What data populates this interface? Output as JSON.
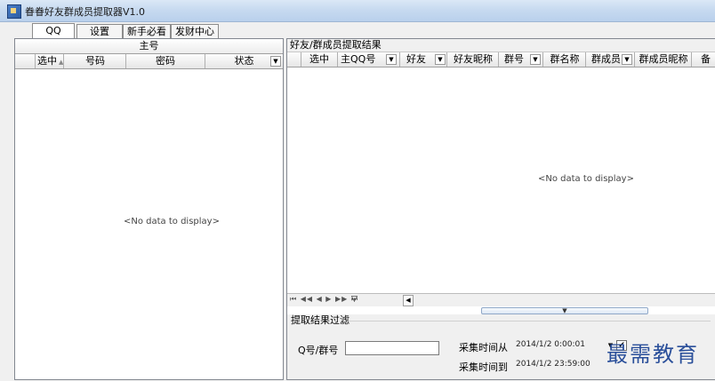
{
  "window": {
    "title": "眷眷好友群成员提取器V1.0"
  },
  "tabs": [
    {
      "label": "QQ"
    },
    {
      "label": "设置"
    },
    {
      "label": "新手必看"
    },
    {
      "label": "发财中心"
    }
  ],
  "left_grid": {
    "band_title": "主号",
    "columns": [
      "选中",
      "号码",
      "密码",
      "状态"
    ],
    "sort_glyph": "▲",
    "filter_glyph": "▼",
    "empty_text": "<No data to display>"
  },
  "right_grid": {
    "group_title": "好友/群成员提取结果",
    "columns": [
      "选中",
      "主QQ号",
      "好友",
      "好友昵称",
      "群号",
      "群名称",
      "群成员",
      "群成员昵称",
      "备"
    ],
    "filter_glyph": "▼",
    "empty_text": "<No data to display>",
    "nav_text": "⏮ ◀◀ ◀ ▶ ▶▶ ⏭",
    "filter_icon": "funnel-icon",
    "nav_side": "◀",
    "splitter_glyph": "▼"
  },
  "filter": {
    "legend": "提取结果过滤",
    "qq_label": "Q号/群号",
    "qq_value": "",
    "from_label": "采集时间从",
    "from_value": "2014/1/2 0:00:01",
    "to_label": "采集时间到",
    "to_value": "2014/1/2 23:59:00",
    "combo_glyph": "▼",
    "from_checked_glyph": "✔"
  },
  "watermark": "最需教育",
  "colors": {
    "title_bar": "#c7daf0",
    "watermark": "#2a4f9a"
  }
}
